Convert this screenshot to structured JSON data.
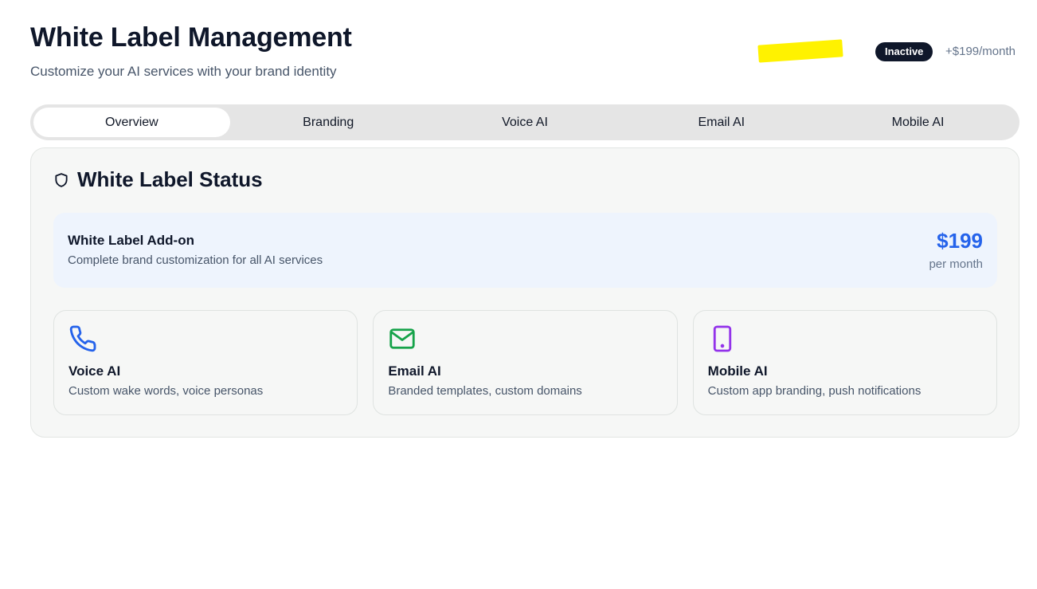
{
  "header": {
    "title": "White Label Management",
    "subtitle": "Customize your AI services with your brand identity",
    "status_badge": "Inactive",
    "price_note": "+$199/month"
  },
  "tabs": [
    {
      "label": "Overview",
      "active": true
    },
    {
      "label": "Branding",
      "active": false
    },
    {
      "label": "Voice AI",
      "active": false
    },
    {
      "label": "Email AI",
      "active": false
    },
    {
      "label": "Mobile AI",
      "active": false
    }
  ],
  "status_card": {
    "heading": "White Label Status",
    "heading_icon": "shield-icon",
    "addon": {
      "title": "White Label Add-on",
      "description": "Complete brand customization for all AI services",
      "price": "$199",
      "period": "per month"
    },
    "features": [
      {
        "title": "Voice AI",
        "description": "Custom wake words, voice personas",
        "icon": "phone-icon",
        "color": "#2563eb"
      },
      {
        "title": "Email AI",
        "description": "Branded templates, custom domains",
        "icon": "mail-icon",
        "color": "#16a34a"
      },
      {
        "title": "Mobile AI",
        "description": "Custom app branding, push notifications",
        "icon": "smartphone-icon",
        "color": "#9333ea"
      }
    ]
  },
  "colors": {
    "accent_blue": "#2563eb",
    "badge_bg": "#0f172a",
    "highlight": "#fff200"
  }
}
